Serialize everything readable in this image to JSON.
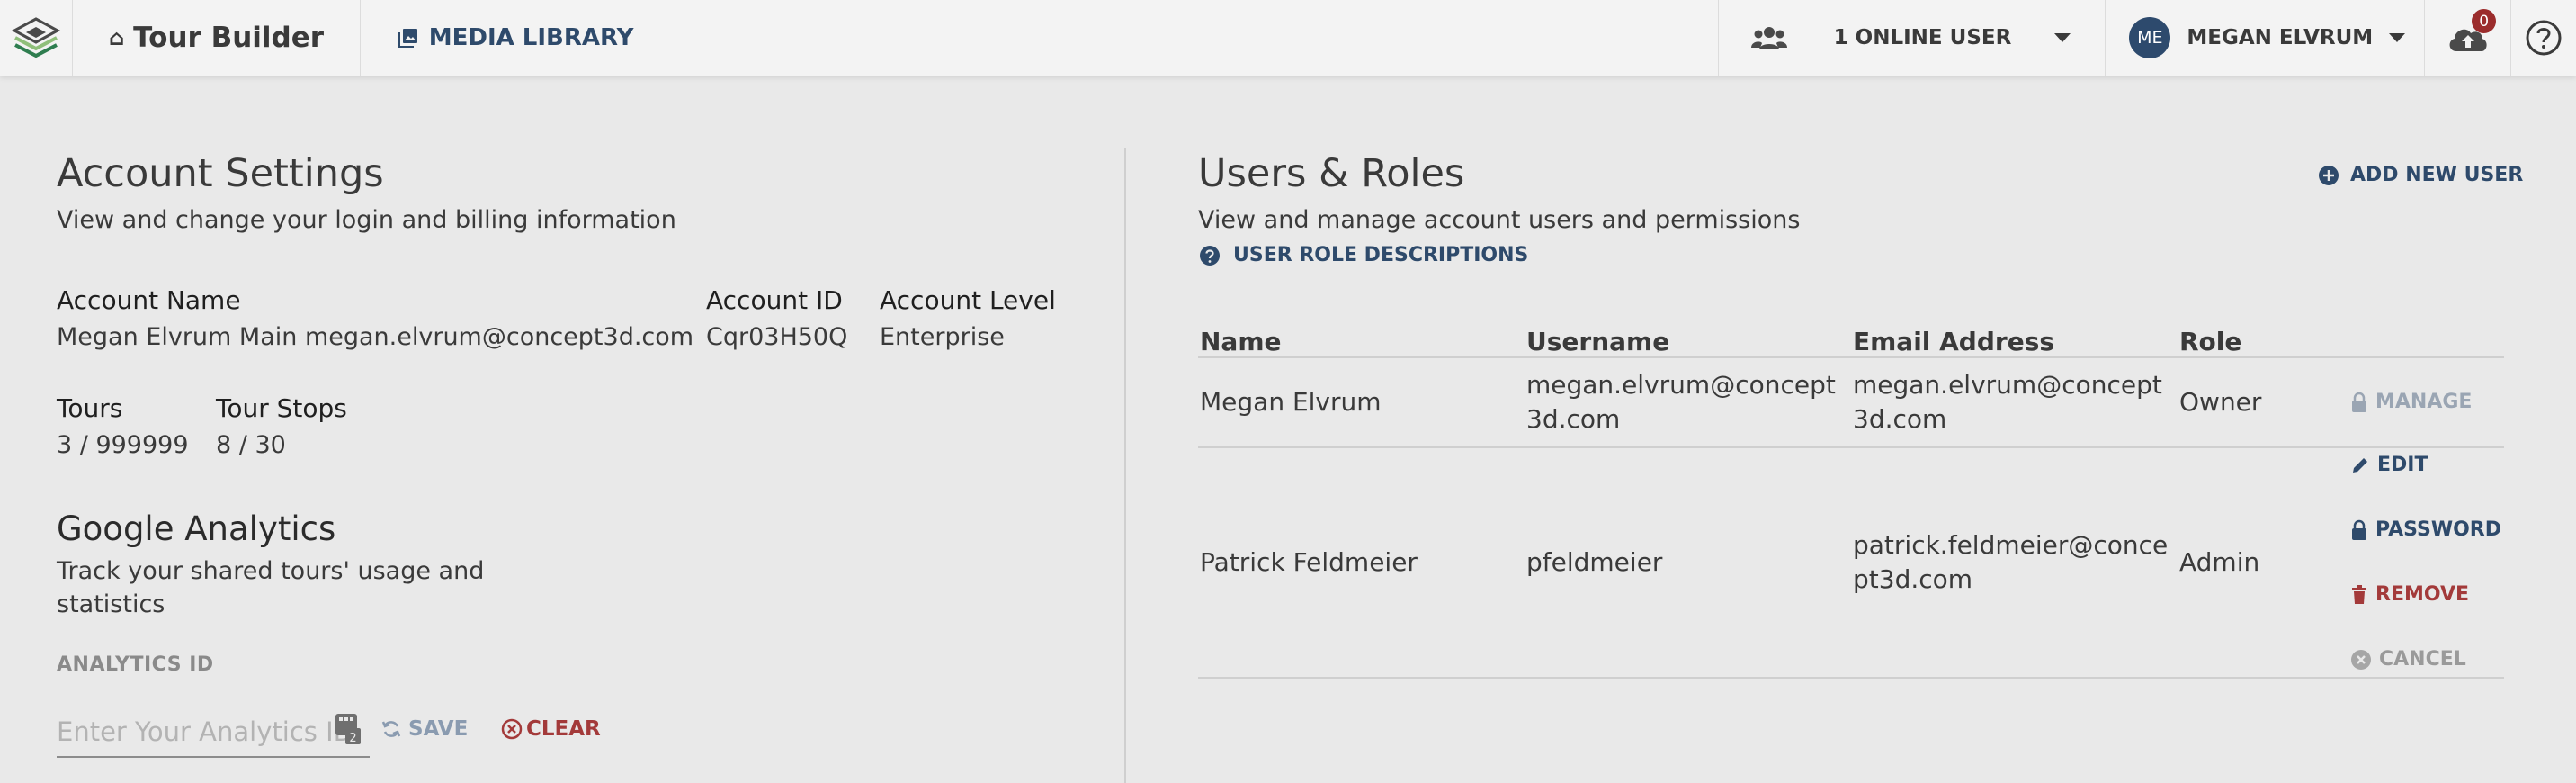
{
  "topbar": {
    "app_name": "Tour Builder",
    "media_library": "MEDIA LIBRARY",
    "online_users": "1 ONLINE USER",
    "user_initials": "ME",
    "user_name": "MEGAN ELVRUM",
    "notification_count": "0"
  },
  "account": {
    "title": "Account Settings",
    "subtitle": "View and change your login and billing information",
    "name_label": "Account Name",
    "name_value": "Megan Elvrum Main megan.elvrum@concept3d.com",
    "id_label": "Account ID",
    "id_value": "Cqr03H50Q",
    "level_label": "Account Level",
    "level_value": "Enterprise",
    "tours_label": "Tours",
    "tours_value": "3 / 999999",
    "stops_label": "Tour Stops",
    "stops_value": "8 / 30"
  },
  "analytics": {
    "title": "Google Analytics",
    "subtitle_line1": "Track your shared tours' usage and",
    "subtitle_line2": "statistics",
    "field_label": "ANALYTICS ID",
    "placeholder": "Enter Your Analytics ID",
    "save_label": "SAVE",
    "clear_label": "CLEAR"
  },
  "users": {
    "title": "Users & Roles",
    "subtitle": "View and manage account users and permissions",
    "role_descriptions": "USER ROLE DESCRIPTIONS",
    "add_new": "ADD NEW USER",
    "columns": [
      "Name",
      "Username",
      "Email Address",
      "Role"
    ],
    "rows": [
      {
        "name": "Megan Elvrum",
        "username_l1": "megan.elvrum@concept",
        "username_l2": "3d.com",
        "email_l1": "megan.elvrum@concept",
        "email_l2": "3d.com",
        "role": "Owner",
        "manage": "MANAGE"
      },
      {
        "name": "Patrick Feldmeier",
        "username": "pfeldmeier",
        "email_l1": "patrick.feldmeier@conce",
        "email_l2": "pt3d.com",
        "role": "Admin",
        "edit": "EDIT",
        "password": "PASSWORD",
        "remove": "REMOVE",
        "cancel": "CANCEL"
      }
    ]
  },
  "colors": {
    "navy": "#2e4a6b",
    "danger": "#a33a3a",
    "muted": "#9aa5b3"
  }
}
